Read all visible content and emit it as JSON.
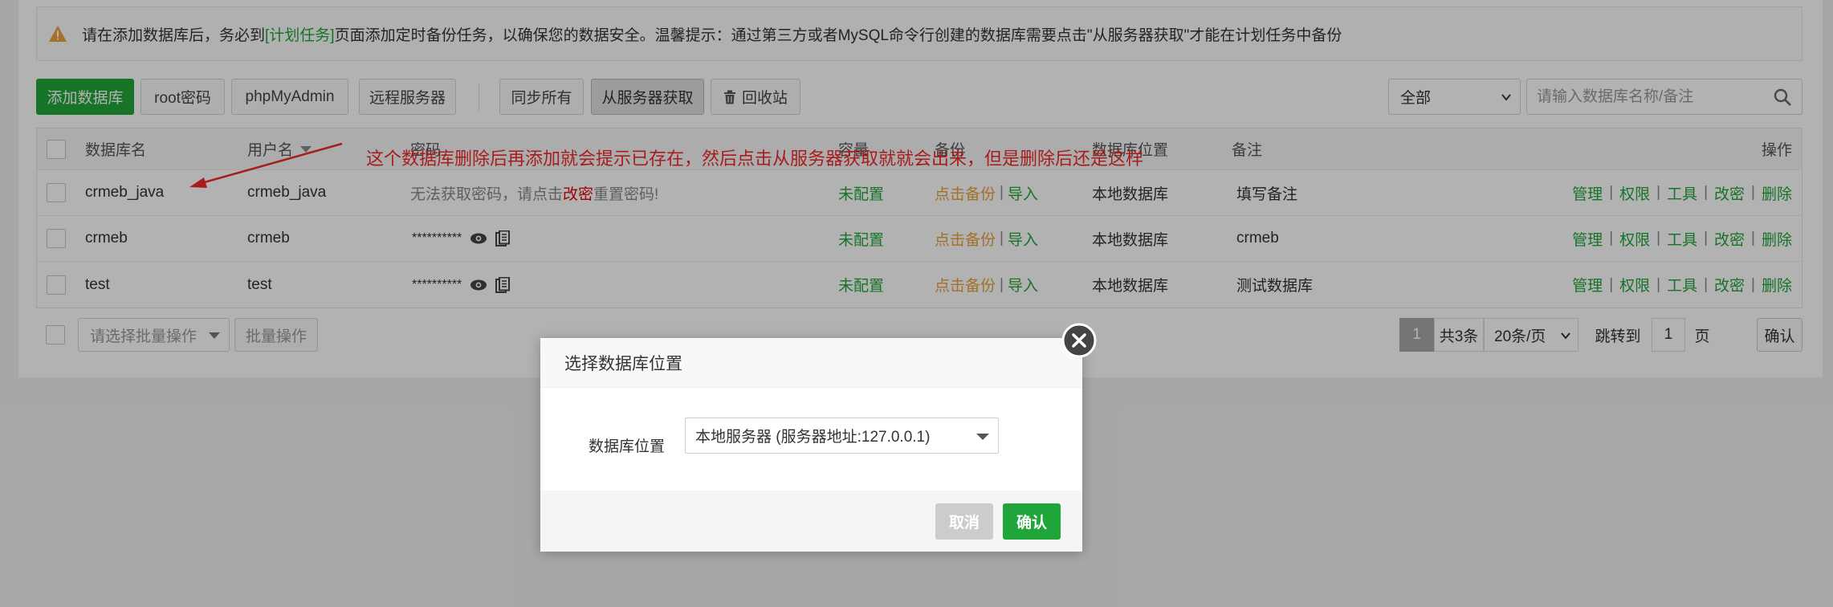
{
  "notice": {
    "text_before": "请在添加数据库后，务必到",
    "link": "[计划任务]",
    "text_after": "页面添加定时备份任务，以确保您的数据安全。温馨提示：通过第三方或者MySQL命令行创建的数据库需要点击\"从服务器获取\"才能在计划任务中备份"
  },
  "toolbar": {
    "add_db": "添加数据库",
    "root_pwd": "root密码",
    "phpmyadmin": "phpMyAdmin",
    "remote_server": "远程服务器",
    "sync_all": "同步所有",
    "fetch_from_server": "从服务器获取",
    "recycle_bin": "回收站",
    "filter_select": "全部",
    "search_placeholder": "请输入数据库名称/备注"
  },
  "table": {
    "headers": {
      "db_name": "数据库名",
      "username": "用户名",
      "password": "密码",
      "capacity": "容量",
      "backup": "备份",
      "location": "数据库位置",
      "remark": "备注",
      "actions": "操作"
    },
    "rows": [
      {
        "db_name": "crmeb_java",
        "username": "crmeb_java",
        "password_msg_a": "无法获取密码，请点击",
        "password_msg_link": "改密",
        "password_msg_b": "重置密码!",
        "capacity": "未配置",
        "backup_link": "点击备份",
        "import_link": "导入",
        "location": "本地数据库",
        "remark": "填写备注"
      },
      {
        "db_name": "crmeb",
        "username": "crmeb",
        "password_mask": "**********",
        "capacity": "未配置",
        "backup_link": "点击备份",
        "import_link": "导入",
        "location": "本地数据库",
        "remark": "crmeb"
      },
      {
        "db_name": "test",
        "username": "test",
        "password_mask": "**********",
        "capacity": "未配置",
        "backup_link": "点击备份",
        "import_link": "导入",
        "location": "本地数据库",
        "remark": "测试数据库"
      }
    ],
    "actions": [
      "管理",
      "权限",
      "工具",
      "改密",
      "删除"
    ]
  },
  "footer": {
    "batch_select_placeholder": "请选择批量操作",
    "batch_btn": "批量操作",
    "current_page": "1",
    "total": "共3条",
    "per_page": "20条/页",
    "jump_label": "跳转到",
    "jump_value": "1",
    "page_unit": "页",
    "confirm": "确认"
  },
  "annotation": "这个数据库删除后再添加就会提示已存在，然后点击从服务器获取就就会出来，但是删除后还是这样",
  "dialog": {
    "title": "选择数据库位置",
    "label": "数据库位置",
    "select_value": "本地服务器 (服务器地址:127.0.0.1)",
    "cancel": "取消",
    "confirm": "确认"
  },
  "colors": {
    "primary_green": "#20a53a",
    "backup_orange": "#e8a13a",
    "annotation_red": "#f02a2a",
    "cancel_gray": "#cccccc"
  }
}
